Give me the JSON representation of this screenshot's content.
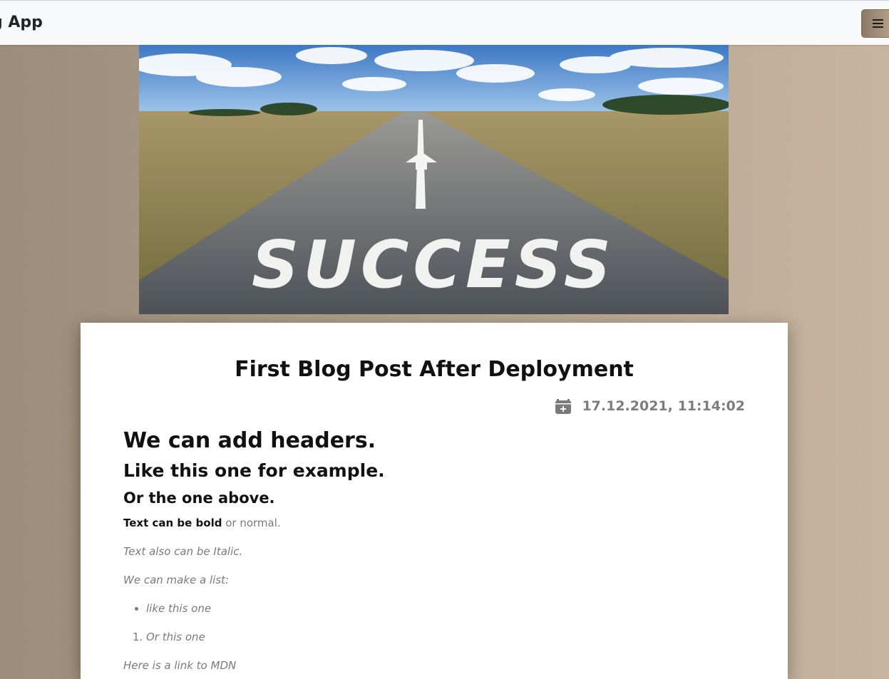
{
  "navbar": {
    "brand": "g App",
    "menu_icon": "hamburger-menu-icon"
  },
  "hero": {
    "image_alt": "Road with SUCCESS painted on it",
    "road_text": "SUCCESS"
  },
  "post": {
    "title": "First Blog Post After Deployment",
    "date_icon": "calendar-plus-icon",
    "date": "17.12.2021, 11:14:02",
    "h1": "We can add headers.",
    "h2": "Like this one for example.",
    "h3": "Or the one above.",
    "bold_text": "Text can be bold",
    "normal_text": " or normal.",
    "italic_text": "Text also can be Italic.",
    "list_intro": "We can make a list:",
    "bullet_item": "like this one",
    "ordered_item": "Or this one",
    "cut_off_text": "Here is a link to MDN"
  },
  "colors": {
    "background_left": "#9c8c7a",
    "background_right": "#c8b4a0",
    "navbar": "#f8f9fa",
    "card": "#ffffff",
    "muted_text": "#7a7a7a"
  }
}
